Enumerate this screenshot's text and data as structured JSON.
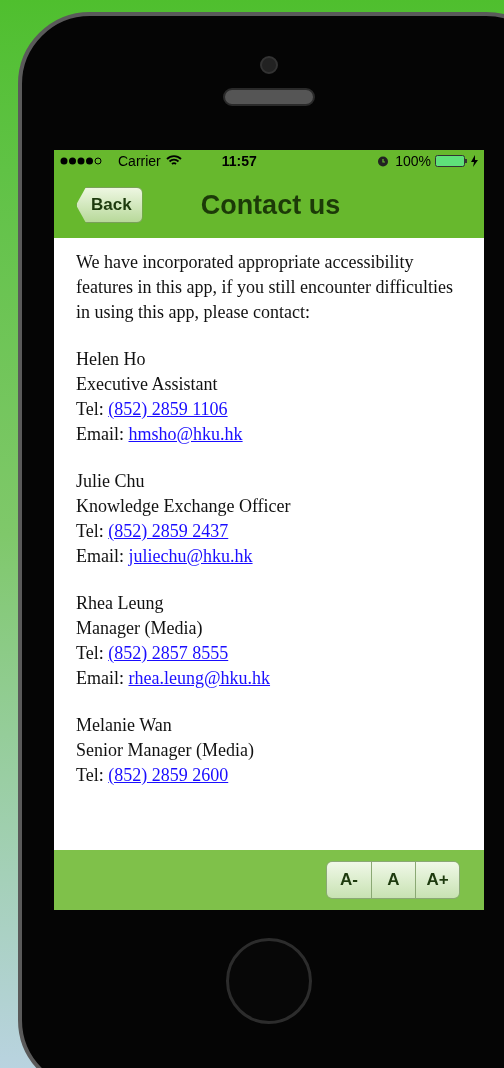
{
  "status_bar": {
    "carrier": "Carrier",
    "time": "11:57",
    "battery": "100%"
  },
  "nav_bar": {
    "back": "Back",
    "title": "Contact us"
  },
  "intro": "We have incorporated appropriate accessibility features in this app, if you still encounter difficulties in using this app, please contact:",
  "contacts": [
    {
      "name": "Helen Ho",
      "role": "Executive Assistant",
      "tel_label": "Tel:",
      "tel": "(852) 2859 1106",
      "email_label": "Email:",
      "email": "hmsho@hku.hk"
    },
    {
      "name": "Julie Chu",
      "role": "Knowledge Exchange Officer",
      "tel_label": "Tel:",
      "tel": "(852) 2859 2437",
      "email_label": "Email:",
      "email": "juliechu@hku.hk"
    },
    {
      "name": "Rhea Leung",
      "role": "Manager (Media)",
      "tel_label": "Tel:",
      "tel": "(852) 2857 8555",
      "email_label": "Email:",
      "email": "rhea.leung@hku.hk"
    },
    {
      "name": "Melanie Wan",
      "role": "Senior Manager (Media)",
      "tel_label": "Tel:",
      "tel": "(852) 2859 2600"
    }
  ],
  "font_size_buttons": [
    "A-",
    "A",
    "A+"
  ]
}
